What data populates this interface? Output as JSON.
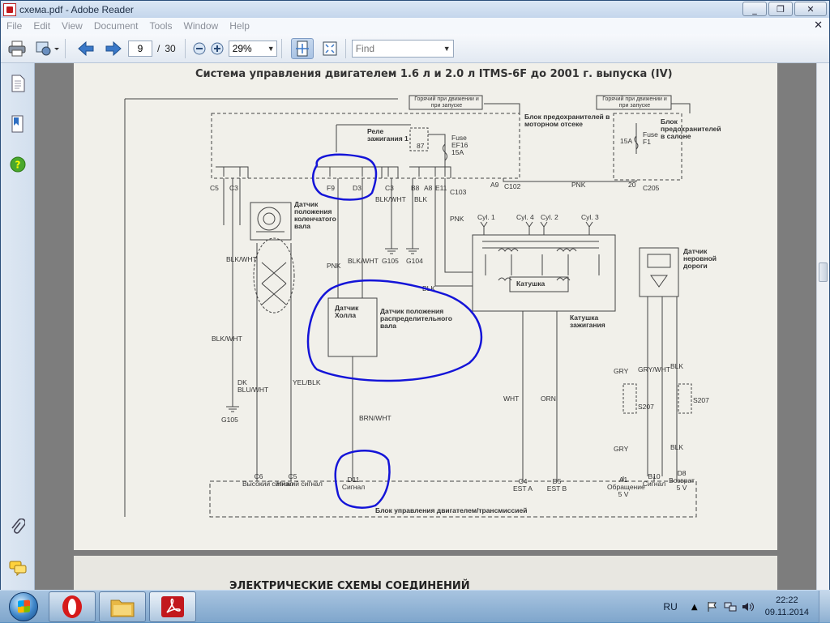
{
  "window": {
    "title": "схема.pdf - Adobe Reader",
    "min": "_",
    "max": "❐",
    "close": "✕"
  },
  "menu": [
    "File",
    "Edit",
    "View",
    "Document",
    "Tools",
    "Window",
    "Help"
  ],
  "menu_close": "✕",
  "toolbar": {
    "page_current": "9",
    "page_separator": "/",
    "page_total": "30",
    "zoom": "29%",
    "find_placeholder": "Find"
  },
  "document": {
    "title": "Система управления двигателем 1.6 л и 2.0 л ITMS-6F до 2001 г. выпуска (IV)",
    "hot_label_1": "Горячий при движении и при запуске",
    "hot_label_2": "Горячий при движении и при запуске",
    "fuse_block_engine": "Блок предохранителей в моторном отсеке",
    "fuse_block_cabin": "Блок предохранителей в салоне",
    "relay": "Реле зажигания 1",
    "relay_pin": "87",
    "fuse_ef16": "Fuse EF16 15A",
    "fuse_f1": "Fuse F1",
    "fuse_f1_rating": "15A",
    "crank_sensor": "Датчик положения коленчатого вала",
    "cam_sensor": "Датчик положения распределительного вала",
    "hall_sensor": "Датчик Холла",
    "rough_road_sensor": "Датчик неровной дороги",
    "ignition_coil": "Катушка зажигания",
    "coil_inner": "Катушка",
    "cyl1": "Cyl. 1",
    "cyl2": "Cyl. 2",
    "cyl3": "Cyl. 3",
    "cyl4": "Cyl. 4",
    "ecu": "Блок управления двигателем/трансмиссией",
    "connectors": [
      "C5",
      "C3",
      "F9",
      "D3",
      "C3",
      "B8",
      "A8",
      "E11",
      "C103",
      "A9",
      "C102",
      "20",
      "C205"
    ],
    "wires": {
      "pnk1": "PNK",
      "pnk2": "PNK",
      "pnk3": "PNK",
      "blk_wht1": "BLK/WHT",
      "blk_wht2": "BLK/WHT",
      "blk_wht3": "BLK/WHT",
      "blk_wht4": "BLK/WHT",
      "blk1": "BLK",
      "blk2": "BLK",
      "blk3": "BLK",
      "blk4": "BLK",
      "dk_blu_wht": "DK BLU/WHT",
      "yel_blk": "YEL/BLK",
      "brn_wht": "BRN/WHT",
      "wht": "WHT",
      "orn": "ORN",
      "gry1": "GRY",
      "gry2": "GRY",
      "gry_wht": "GRY/WHT"
    },
    "grounds": [
      "G105",
      "G104",
      "G105"
    ],
    "ecu_pins": [
      {
        "pin": "C6",
        "desc": "Высокий сигнал"
      },
      {
        "pin": "C5",
        "desc": "Низкий сигнал"
      },
      {
        "pin": "D11",
        "desc": "Сигнал"
      },
      {
        "pin": "C4",
        "desc": "EST A"
      },
      {
        "pin": "D5",
        "desc": "EST B"
      },
      {
        "pin": "A1",
        "desc": "Обращение 5 V"
      },
      {
        "pin": "B10",
        "desc": "Сигнал"
      },
      {
        "pin": "D8",
        "desc": "Возврат 5 V"
      }
    ],
    "splices": [
      "S207",
      "S207"
    ],
    "next_page_heading": "ЭЛЕКТРИЧЕСКИЕ СХЕМЫ СОЕДИНЕНИЙ"
  },
  "taskbar": {
    "lang": "RU",
    "time": "22:22",
    "date": "09.11.2014"
  },
  "colors": {
    "annotation": "#1414d8",
    "title_gradient_top": "#dbe7f4"
  }
}
